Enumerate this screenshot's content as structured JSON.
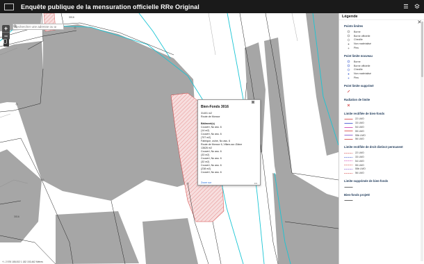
{
  "header": {
    "title": "Enquête publique de la mensuration officielle RRe Original"
  },
  "search": {
    "placeholder": "Rechercher une adresse ou un lieu"
  },
  "zoom": {
    "in": "+",
    "out": "−"
  },
  "map_labels": {
    "parcel_a": "3016",
    "parcel_b": "3016"
  },
  "popup": {
    "title": "Bien-Fonds 3016",
    "lines": [
      "31401 m2",
      "Route de Moncor"
    ],
    "section_title": "Bâtiment(s)",
    "building_lines": [
      "Couvert, No ass. 6",
      "(14 m2)",
      "Couvert, No ass. 6",
      "(707 m2)",
      "Fabrique, usine, No ass. 6",
      "Route de Moncor 6, Villars-sur-Glâne",
      "13626 m2",
      "Couvert, No ass. 6",
      "(33 m2)",
      "Couvert, No ass. 6",
      "(32 m2)",
      "Couvert, No ass. 6",
      "(238 m2)",
      "Couvert, No ass. 6"
    ],
    "link": "Zoom sur",
    "more": "•••"
  },
  "scale_text": "+/- 2 576 185,002 1 182 153,462 Mètres",
  "legend": {
    "title": "Légende",
    "sections": [
      {
        "title": "Points limites",
        "items": [
          {
            "label": "Borne",
            "sym": "circle",
            "color": "#666666"
          },
          {
            "label": "Borne officielle",
            "sym": "circle",
            "color": "#666666"
          },
          {
            "label": "Cheville",
            "sym": "diamond",
            "color": "#666666"
          },
          {
            "label": "Non matérialisé",
            "sym": "dot",
            "color": "#666666"
          },
          {
            "label": "Pieu",
            "sym": "small",
            "color": "#666666"
          }
        ]
      },
      {
        "title": "Point limite nouveau",
        "items": [
          {
            "label": "Borne",
            "sym": "circle",
            "color": "#3355cc"
          },
          {
            "label": "Borne officielle",
            "sym": "circle",
            "color": "#3355cc"
          },
          {
            "label": "Cheville",
            "sym": "diamond",
            "color": "#3355cc"
          },
          {
            "label": "Non matérialisé",
            "sym": "dot",
            "color": "#3355cc"
          },
          {
            "label": "Pieu",
            "sym": "small",
            "color": "#3355cc"
          }
        ]
      },
      {
        "title": "Point limite supprimé",
        "items": [
          {
            "label": "",
            "sym": "slash",
            "color": "#d03030"
          }
        ]
      },
      {
        "title": "Radiation de limite",
        "items": [
          {
            "label": "",
            "sym": "cross",
            "color": "#d03030"
          }
        ]
      },
      {
        "title": "Limite rectifiée de bien-fonds",
        "items": [
          {
            "label": "22 LMO",
            "sym": "line",
            "color": "#d23c3c"
          },
          {
            "label": "33 LMO",
            "sym": "line",
            "color": "#3344cc"
          },
          {
            "label": "54 LMO",
            "sym": "line",
            "color": "#cc33aa"
          },
          {
            "label": "55 LMO",
            "sym": "line",
            "color": "#d23c3c"
          },
          {
            "label": "55b LMO",
            "sym": "line",
            "color": "#7744cc"
          },
          {
            "label": "56 LMO",
            "sym": "line",
            "color": "#d23c3c"
          }
        ]
      },
      {
        "title": "Limite rectifiée de droit distinct permanent",
        "items": [
          {
            "label": "22 LMO",
            "sym": "dash",
            "color": "#d23c3c"
          },
          {
            "label": "33 LMO",
            "sym": "dash",
            "color": "#3344cc"
          },
          {
            "label": "54 LMO",
            "sym": "dash",
            "color": "#cc33aa"
          },
          {
            "label": "55 LMO",
            "sym": "dash",
            "color": "#d23c3c"
          },
          {
            "label": "55b LMO",
            "sym": "dash",
            "color": "#7744cc"
          },
          {
            "label": "56 LMO",
            "sym": "dash",
            "color": "#d23c3c"
          }
        ]
      },
      {
        "title": "Limite supprimée de bien-fonds",
        "items": [
          {
            "label": "",
            "sym": "line",
            "color": "#444444"
          }
        ]
      },
      {
        "title": "Bien-fonds projeté",
        "items": [
          {
            "label": "",
            "sym": "line",
            "color": "#444444"
          }
        ]
      }
    ]
  },
  "colors": {
    "building": "#a6a6a6",
    "road": "#f5f5f5",
    "cyan_line": "#19c5d4",
    "parcel_line": "#222222",
    "hatch": "#e07070"
  }
}
